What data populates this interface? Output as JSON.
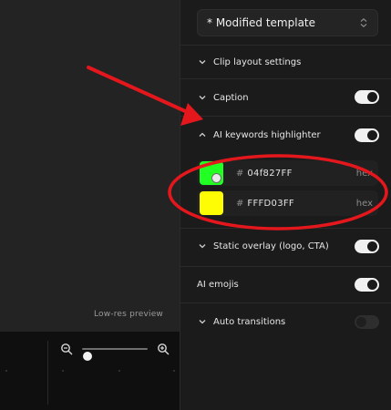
{
  "preview": {
    "tag": "Low-res preview"
  },
  "zoom": {
    "level_fraction": 0.08,
    "zoom_out_icon": "zoom-out-icon",
    "zoom_in_icon": "zoom-in-icon"
  },
  "panel": {
    "template_select": {
      "value": "* Modified template",
      "icon": "chevron-updown-icon"
    },
    "sections": {
      "clip_layout": {
        "label": "Clip layout settings",
        "expanded": false
      },
      "caption": {
        "label": "Caption",
        "expanded": false,
        "enabled": true
      },
      "keywords": {
        "label": "AI keywords highlighter",
        "expanded": true,
        "enabled": true
      },
      "static_overlay": {
        "label": "Static overlay (logo, CTA)",
        "expanded": false,
        "enabled": true
      },
      "emojis": {
        "label": "AI emojis",
        "enabled": true
      },
      "transitions": {
        "label": "Auto transitions",
        "expanded": false,
        "enabled": false
      }
    },
    "colors": [
      {
        "swatch": "#22FF22",
        "hash": "#",
        "value": "04f827FF",
        "format": "hex"
      },
      {
        "swatch": "#FFFD03",
        "hash": "#",
        "value": "FFFD03FF",
        "format": "hex"
      }
    ]
  },
  "annotation": {
    "color": "#E3171C"
  }
}
